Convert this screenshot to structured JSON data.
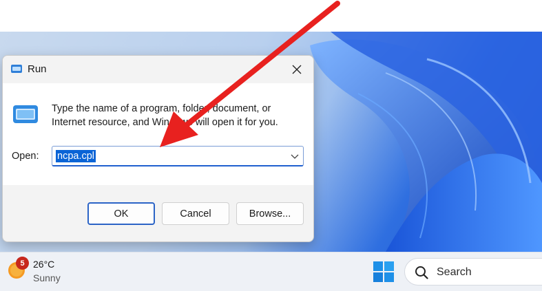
{
  "dialog": {
    "title": "Run",
    "description_line1": "Type the name of a program, folder, document, or",
    "description_line2": "Internet resource, and Windows will open it for you.",
    "open_label": "Open:",
    "open_value": "ncpa.cpl",
    "ok_label": "OK",
    "cancel_label": "Cancel",
    "browse_label": "Browse..."
  },
  "taskbar": {
    "weather_temp": "26°C",
    "weather_condition": "Sunny",
    "weather_badge": "5",
    "search_label": "Search"
  },
  "icons": {
    "run": "run-icon",
    "close": "close-icon",
    "chevron": "chevron-down-icon",
    "weather": "sun-icon",
    "start": "windows-logo-icon",
    "search": "search-icon"
  },
  "colors": {
    "accent": "#0a64d6",
    "arrow": "#e8211f",
    "badge": "#c7271c",
    "wallpaper_blue": "#1f4fc9"
  }
}
